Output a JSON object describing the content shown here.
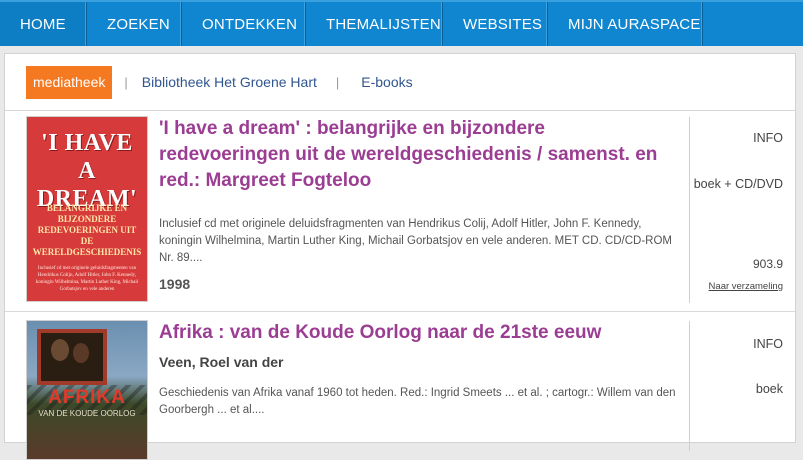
{
  "nav": {
    "items": [
      {
        "label": "HOME"
      },
      {
        "label": "ZOEKEN"
      },
      {
        "label": "ONTDEKKEN"
      },
      {
        "label": "THEMALIJSTEN"
      },
      {
        "label": "WEBSITES"
      },
      {
        "label": "MIJN AURASPACE"
      }
    ]
  },
  "filters": {
    "active": "mediatheek",
    "separator": "|",
    "links": [
      "Bibliotheek Het Groene Hart",
      "E-books"
    ]
  },
  "results": [
    {
      "title": "'I have a dream' : belangrijke en bijzondere redevoeringen uit de wereldgeschiedenis / samenst. en red.: Margreet Fogteloo",
      "description": "Inclusief cd met originele deluidsfragmenten van Hendrikus Colij, Adolf Hitler, John F. Kennedy, koningin Wilhelmina, Martin Luther King, Michail Gorbatsjov en vele anderen. MET CD. CD/CD-ROM Nr. 89....",
      "year": "1998",
      "info": "INFO",
      "type": "boek + CD/DVD",
      "call_number": "903.9",
      "collection_link": "Naar verzameling",
      "cover": {
        "title_line1": "'I HAVE",
        "title_line2": "A DREAM'",
        "subtitle": "BELANGRIJKE EN BIJZONDERE REDEVOERINGEN UIT DE WERELDGESCHIEDENIS",
        "small_text": "Inclusief cd met originele geluidsfragmenten van Hendrikus Colijn, Adolf Hitler, John F. Kennedy, koningin Wilhelmina, Martin Luther King, Michail Gorbatsjov en vele anderen"
      }
    },
    {
      "title": "Afrika : van de Koude Oorlog naar de 21ste eeuw",
      "author": "Veen, Roel van der",
      "description": "Geschiedenis van Afrika vanaf 1960 tot heden. Red.: Ingrid Smeets ... et al. ; cartogr.: Willem van den Goorbergh ... et al....",
      "info": "INFO",
      "type": "boek",
      "cover": {
        "title": "AFRIKA",
        "subtitle": "VAN DE KOUDE OORLOG"
      }
    }
  ],
  "colors": {
    "nav_bg": "#0f86cf",
    "active_filter": "#f47920",
    "title": "#9b3d93",
    "link": "#30568f"
  }
}
